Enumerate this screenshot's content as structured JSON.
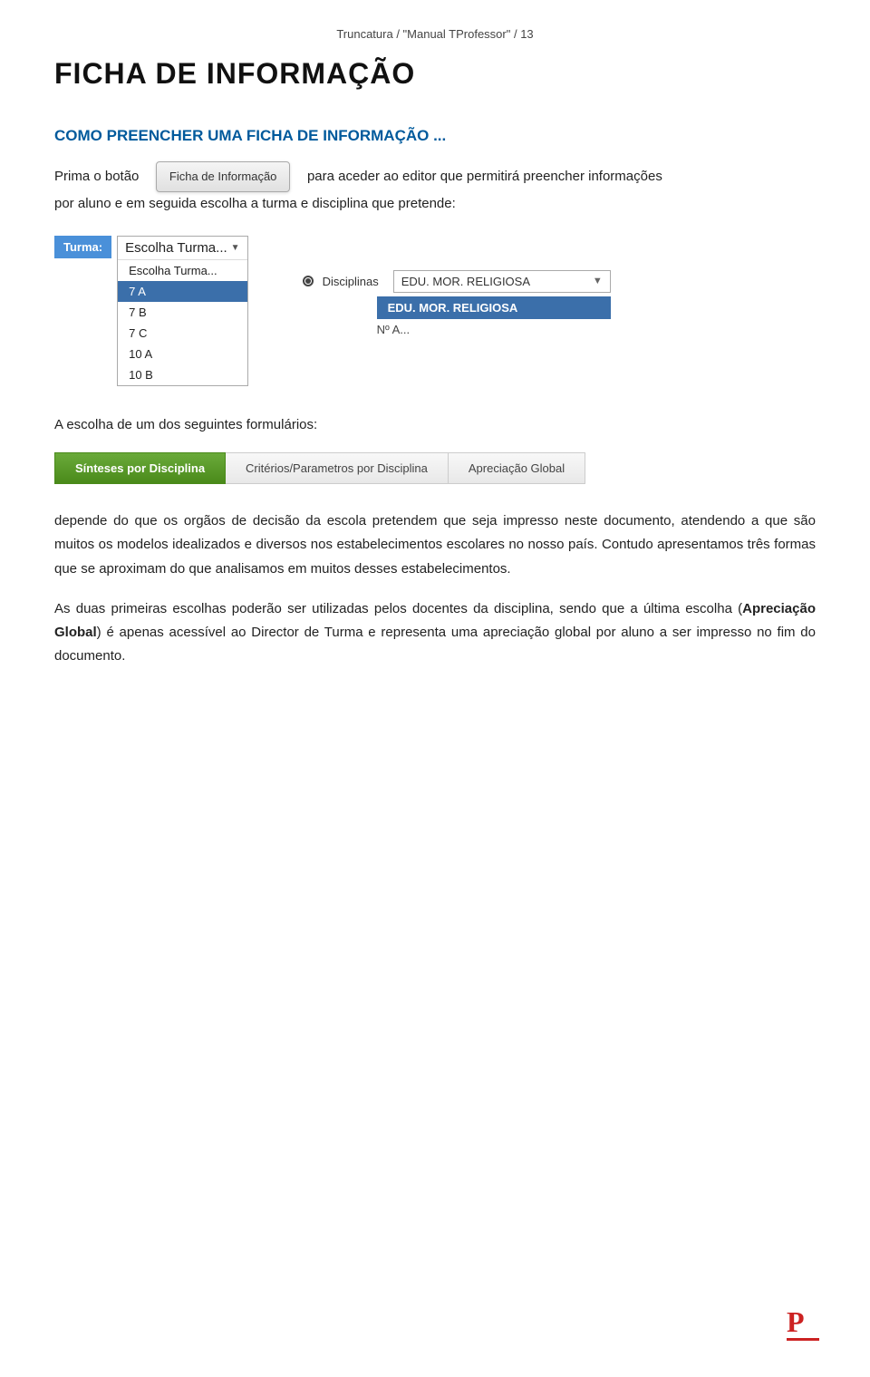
{
  "breadcrumb": "Truncatura / \"Manual TProfessor\" / 13",
  "page_title": "FICHA DE INFORMAÇÃO",
  "section_heading": "COMO PREENCHER UMA FICHA DE INFORMAÇÃO ...",
  "intro_line1": "Prima o botão",
  "button_label": "Ficha de Informação",
  "intro_line2": "para aceder ao editor que permitirá preencher informações",
  "intro_line3": "por aluno e em seguida escolha a turma e disciplina que pretende:",
  "turma": {
    "label": "Turma:",
    "select_placeholder": "Escolha Turma...",
    "items": [
      {
        "label": "Escolha Turma...",
        "selected": false
      },
      {
        "label": "7 A",
        "selected": true
      },
      {
        "label": "7 B",
        "selected": false
      },
      {
        "label": "7 C",
        "selected": false
      },
      {
        "label": "10 A",
        "selected": false
      },
      {
        "label": "10 B",
        "selected": false
      }
    ]
  },
  "disciplinas": {
    "label": "Disciplinas",
    "selected_value": "EDU. MOR. RELIGIOSA",
    "highlighted_value": "EDU. MOR. RELIGIOSA",
    "no_al_label": "Nº A..."
  },
  "formularios_para": "A escolha de um dos seguintes formulários:",
  "tabs": [
    {
      "label": "Sínteses por Disciplina",
      "active": true
    },
    {
      "label": "Critérios/Parametros por Disciplina",
      "active": false
    },
    {
      "label": "Apreciação Global",
      "active": false
    }
  ],
  "body_paragraphs": [
    "depende do que os orgãos de decisão da escola pretendem que seja impresso neste documento, atendendo a que são muitos os modelos idealizados e diversos nos estabelecimentos escolares no nosso país. Contudo apresentamos três formas que se aproximam do que analisamos em muitos desses estabelecimentos.",
    "As duas primeiras escolhas poderão ser utilizadas pelos docentes da disciplina, sendo que a última escolha (Apreciação Global) é apenas acessível ao Director de Turma e representa uma apreciação global por aluno a ser impresso no fim do documento."
  ],
  "body_bold": {
    "apreciacao": "Apreciação Global"
  },
  "logo_letter": "P"
}
